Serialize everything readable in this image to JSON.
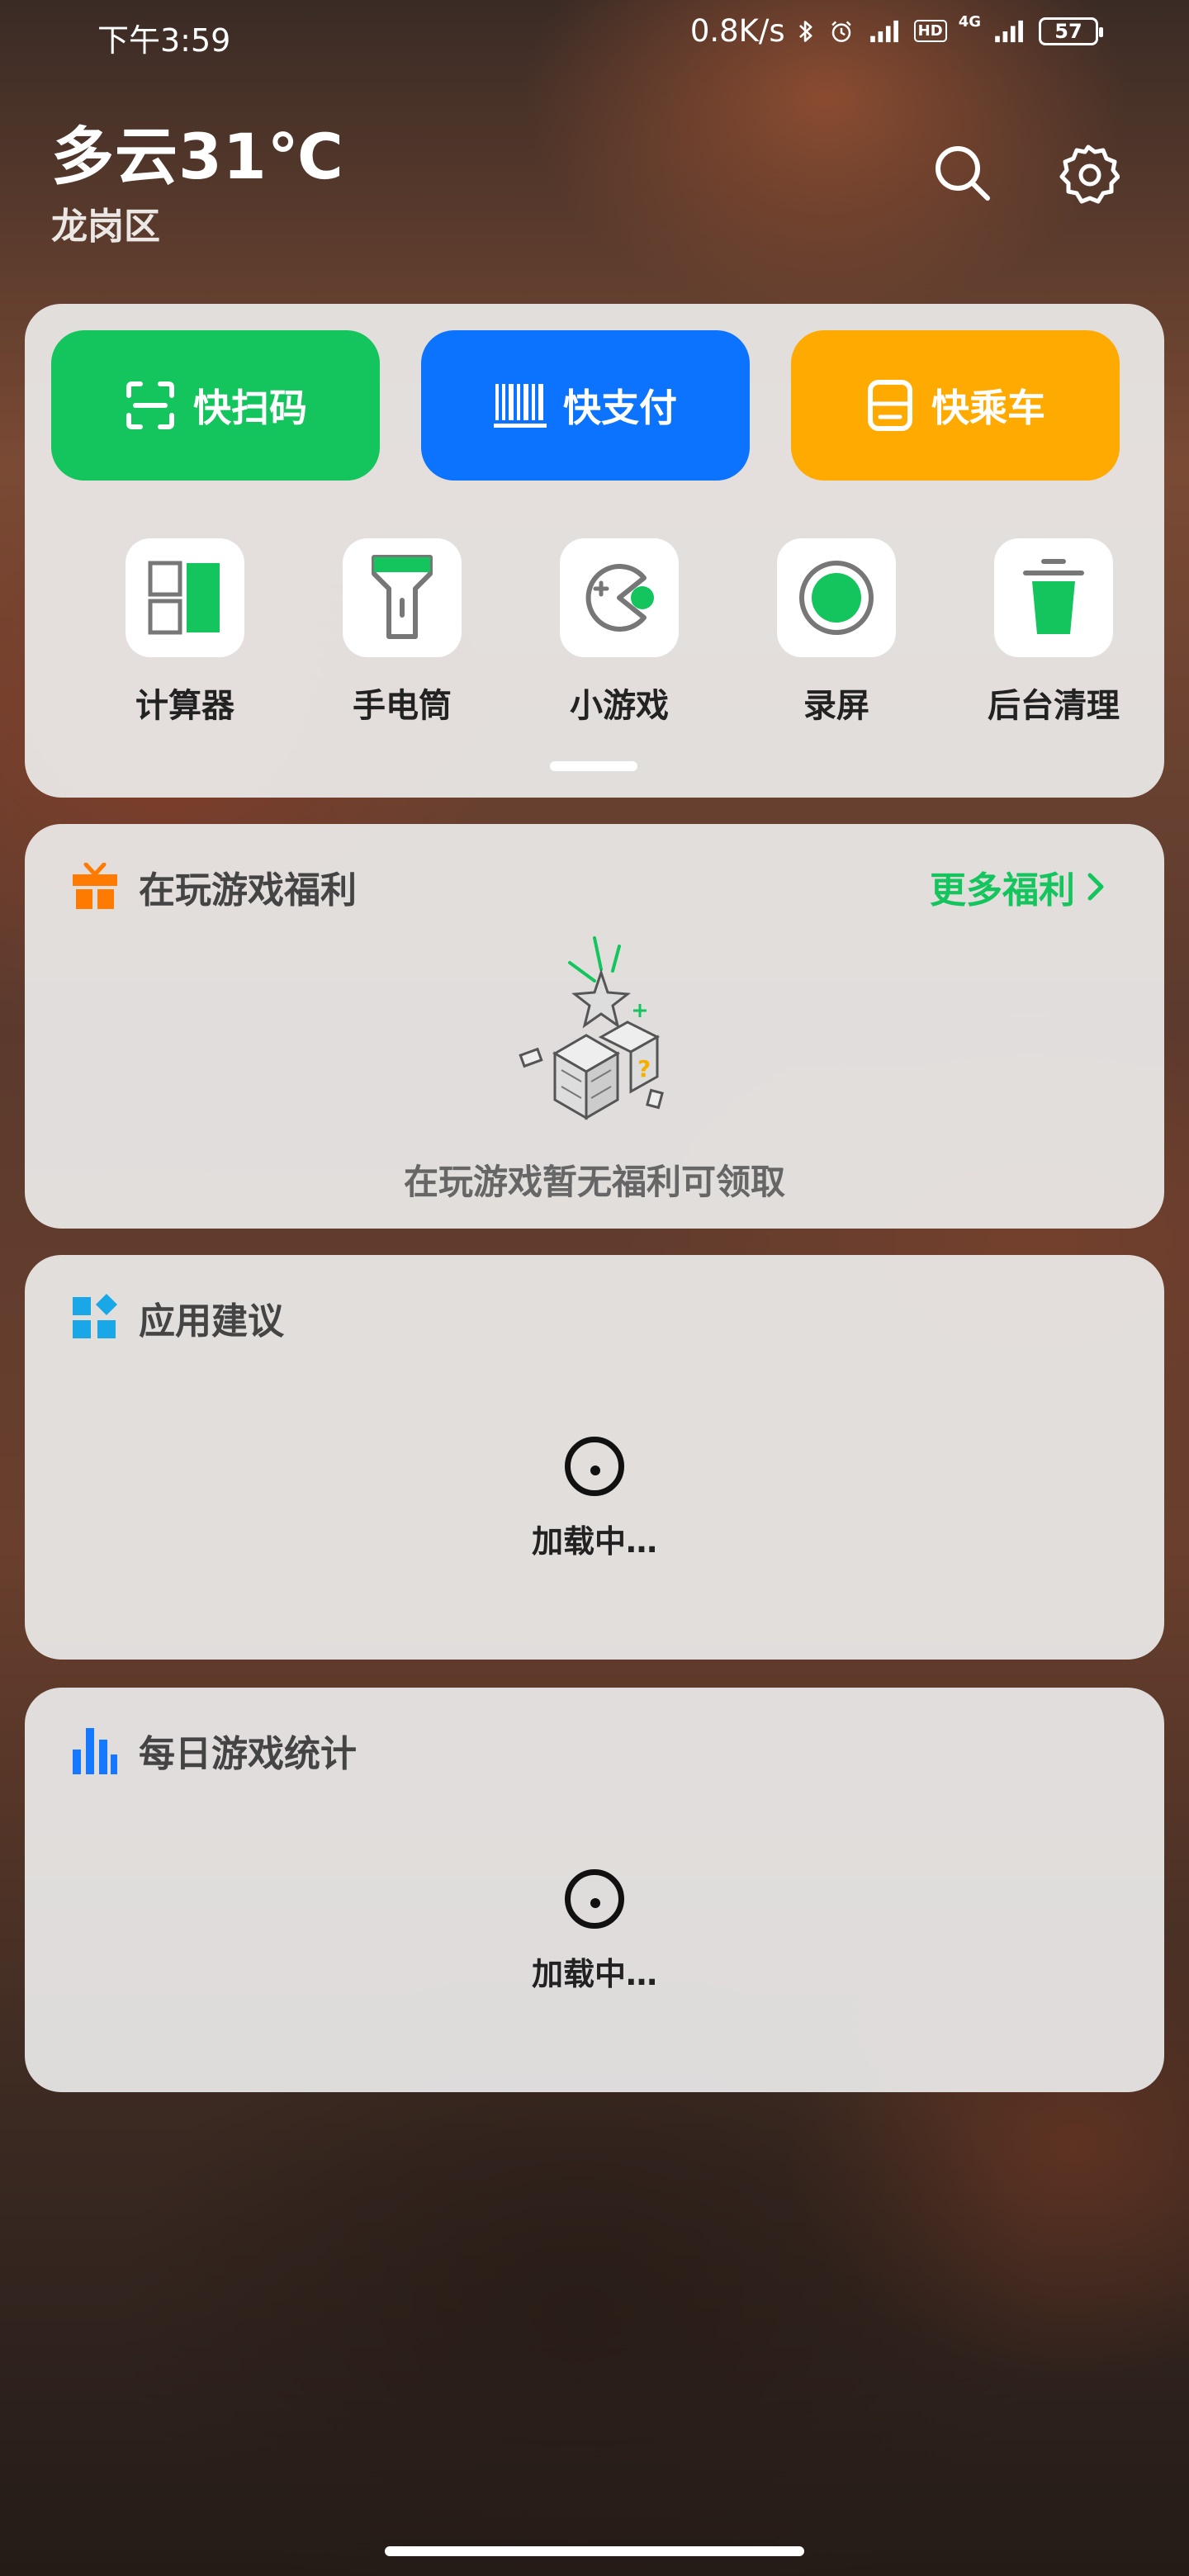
{
  "status_bar": {
    "time": "下午3:59",
    "net_speed": "0.8K/s",
    "hd": "HD",
    "network_type": "4G",
    "battery": "57",
    "icons": [
      "bluetooth-icon",
      "alarm-icon",
      "signal-icon",
      "hd-icon",
      "signal-4g-icon",
      "battery-icon"
    ]
  },
  "header": {
    "weather": "多云31℃",
    "location": "龙岗区",
    "icons": [
      "search-icon",
      "settings-icon"
    ]
  },
  "quick_actions": [
    {
      "label": "快扫码",
      "icon": "scan-icon",
      "color": "#14c45c"
    },
    {
      "label": "快支付",
      "icon": "barcode-icon",
      "color": "#0c73ff"
    },
    {
      "label": "快乘车",
      "icon": "bus-card-icon",
      "color": "#ffaa00"
    }
  ],
  "tools": [
    {
      "label": "计算器",
      "icon": "calculator-icon"
    },
    {
      "label": "手电筒",
      "icon": "flashlight-icon"
    },
    {
      "label": "小游戏",
      "icon": "mini-game-icon"
    },
    {
      "label": "录屏",
      "icon": "screen-record-icon"
    },
    {
      "label": "后台清理",
      "icon": "trash-clean-icon"
    }
  ],
  "gift_card": {
    "title": "在玩游戏福利",
    "more": "更多福利",
    "empty_text": "在玩游戏暂无福利可领取",
    "accent": "#ff7a00"
  },
  "apps_card": {
    "title": "应用建议",
    "loading": "加载中…",
    "accent": "#1aa7e8"
  },
  "stats_card": {
    "title": "每日游戏统计",
    "loading": "加载中…",
    "accent": "#1677ff"
  },
  "colors": {
    "green": "#14c45c",
    "blue": "#0c73ff",
    "orange": "#ffaa00"
  }
}
